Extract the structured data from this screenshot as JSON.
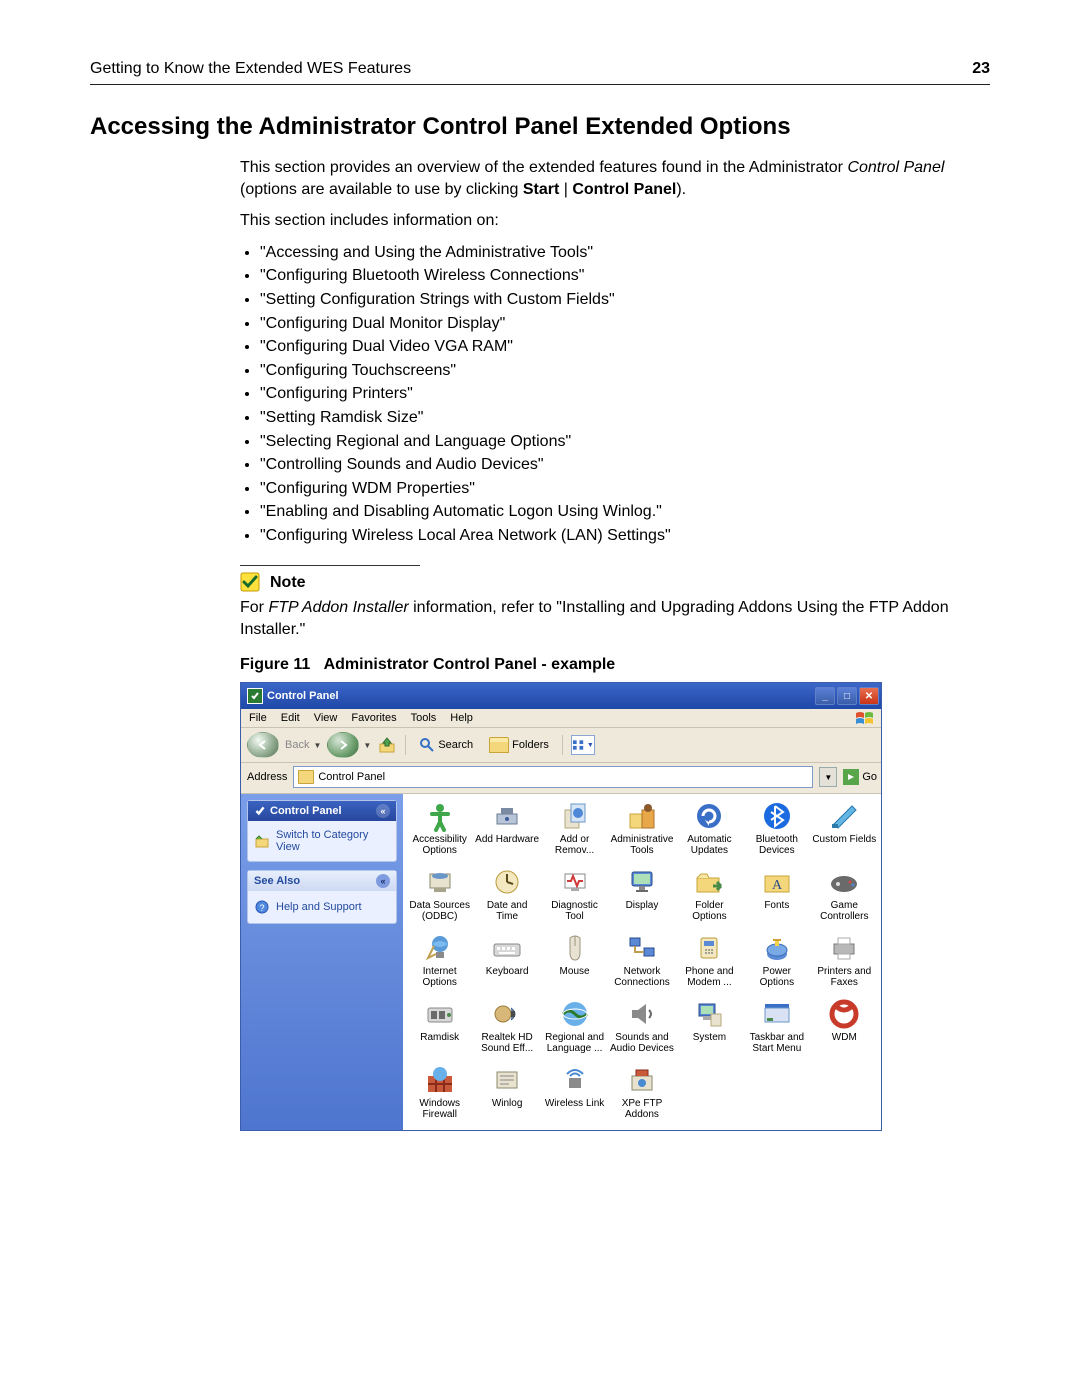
{
  "header": {
    "left": "Getting to Know the Extended WES Features",
    "right": "23"
  },
  "title": "Accessing the Administrator Control Panel Extended Options",
  "intro": {
    "p1_a": "This section provides an overview of the extended features found in the Administrator ",
    "p1_italic": "Control Panel",
    "p1_b": " (options are available to use by clicking ",
    "p1_bold1": "Start",
    "p1_sep": " | ",
    "p1_bold2": "Control Panel",
    "p1_c": ").",
    "p2": "This section includes information on:"
  },
  "bullets": [
    "\"Accessing and Using the Administrative Tools\"",
    "\"Configuring Bluetooth Wireless Connections\"",
    "\"Setting Configuration Strings with Custom Fields\"",
    "\"Configuring Dual Monitor Display\"",
    "\"Configuring Dual Video VGA RAM\"",
    "\"Configuring Touchscreens\"",
    "\"Configuring Printers\"",
    "\"Setting Ramdisk Size\"",
    "\"Selecting Regional and Language Options\"",
    "\"Controlling Sounds and Audio Devices\"",
    "\"Configuring WDM Properties\"",
    "\"Enabling and Disabling Automatic Logon Using Winlog.\"",
    "\"Configuring Wireless Local Area Network (LAN) Settings\""
  ],
  "note": {
    "label": "Note",
    "body_a": "For ",
    "body_italic": "FTP Addon Installer",
    "body_b": " information, refer to \"Installing and Upgrading Addons Using the FTP Addon Installer.\""
  },
  "figure": {
    "prefix": "Figure 11",
    "title": "Administrator Control Panel - example"
  },
  "cp": {
    "title": "Control Panel",
    "menu": [
      "File",
      "Edit",
      "View",
      "Favorites",
      "Tools",
      "Help"
    ],
    "toolbar": {
      "back": "Back",
      "search": "Search",
      "folders": "Folders"
    },
    "address": {
      "label": "Address",
      "value": "Control Panel",
      "go": "Go"
    },
    "sidebar": {
      "panel_title": "Control Panel",
      "switch_link": "Switch to Category View",
      "see_also": "See Also",
      "help_link": "Help and Support"
    },
    "items": [
      {
        "label": "Accessibility Options",
        "icon": "accessibility"
      },
      {
        "label": "Add Hardware",
        "icon": "hardware"
      },
      {
        "label": "Add or Remov...",
        "icon": "addremove"
      },
      {
        "label": "Administrative Tools",
        "icon": "admintools"
      },
      {
        "label": "Automatic Updates",
        "icon": "updates"
      },
      {
        "label": "Bluetooth Devices",
        "icon": "bluetooth"
      },
      {
        "label": "Custom Fields",
        "icon": "custom"
      },
      {
        "label": "Data Sources (ODBC)",
        "icon": "odbc"
      },
      {
        "label": "Date and Time",
        "icon": "datetime"
      },
      {
        "label": "Diagnostic Tool",
        "icon": "diagnostic"
      },
      {
        "label": "Display",
        "icon": "display"
      },
      {
        "label": "Folder Options",
        "icon": "folderopt"
      },
      {
        "label": "Fonts",
        "icon": "fonts"
      },
      {
        "label": "Game Controllers",
        "icon": "game"
      },
      {
        "label": "Internet Options",
        "icon": "inet"
      },
      {
        "label": "Keyboard",
        "icon": "keyboard"
      },
      {
        "label": "Mouse",
        "icon": "mouse"
      },
      {
        "label": "Network Connections",
        "icon": "network"
      },
      {
        "label": "Phone and Modem ...",
        "icon": "phone"
      },
      {
        "label": "Power Options",
        "icon": "power"
      },
      {
        "label": "Printers and Faxes",
        "icon": "printers"
      },
      {
        "label": "Ramdisk",
        "icon": "ramdisk"
      },
      {
        "label": "Realtek HD Sound Eff...",
        "icon": "realtek"
      },
      {
        "label": "Regional and Language ...",
        "icon": "regional"
      },
      {
        "label": "Sounds and Audio Devices",
        "icon": "sounds"
      },
      {
        "label": "System",
        "icon": "system"
      },
      {
        "label": "Taskbar and Start Menu",
        "icon": "taskbar"
      },
      {
        "label": "WDM",
        "icon": "wdm"
      },
      {
        "label": "Windows Firewall",
        "icon": "firewall"
      },
      {
        "label": "Winlog",
        "icon": "winlog"
      },
      {
        "label": "Wireless Link",
        "icon": "wireless"
      },
      {
        "label": "XPe FTP Addons",
        "icon": "xpeftp"
      }
    ]
  }
}
